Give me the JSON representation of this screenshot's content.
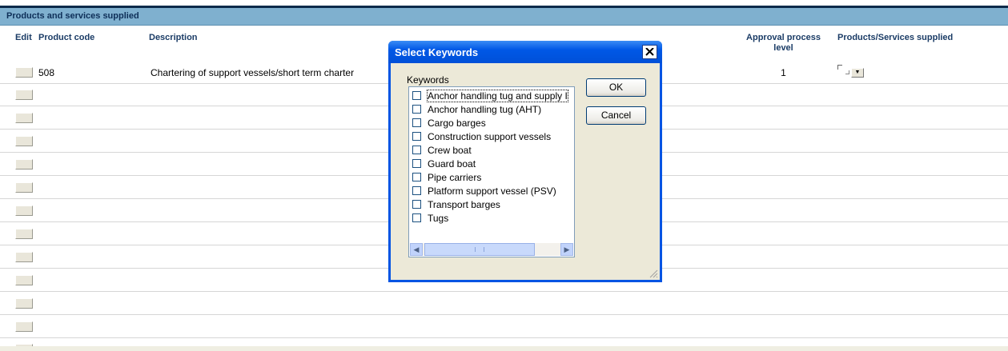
{
  "section": {
    "title": "Products and services supplied"
  },
  "columns": {
    "edit": "Edit",
    "code": "Product code",
    "description": "Description",
    "approval": "Approval process level",
    "products": "Products/Services supplied"
  },
  "rows": [
    {
      "code": "508",
      "description": "Chartering of support vessels/short term charter",
      "approval": "1"
    }
  ],
  "dialog": {
    "title": "Select Keywords",
    "keywords_label": "Keywords",
    "ok_label": "OK",
    "cancel_label": "Cancel",
    "keywords": [
      "Anchor handling tug and supply I",
      "Anchor handling tug (AHT)",
      "Cargo barges",
      "Construction support vessels",
      "Crew boat",
      "Guard boat",
      "Pipe carriers",
      "Platform support vessel (PSV)",
      "Transport barges",
      "Tugs"
    ]
  },
  "icons": {
    "close": "close-icon",
    "dropdown": "chevron-down-icon",
    "scroll_left": "arrow-left-icon",
    "scroll_right": "arrow-right-icon",
    "resize": "resize-grip-icon"
  }
}
